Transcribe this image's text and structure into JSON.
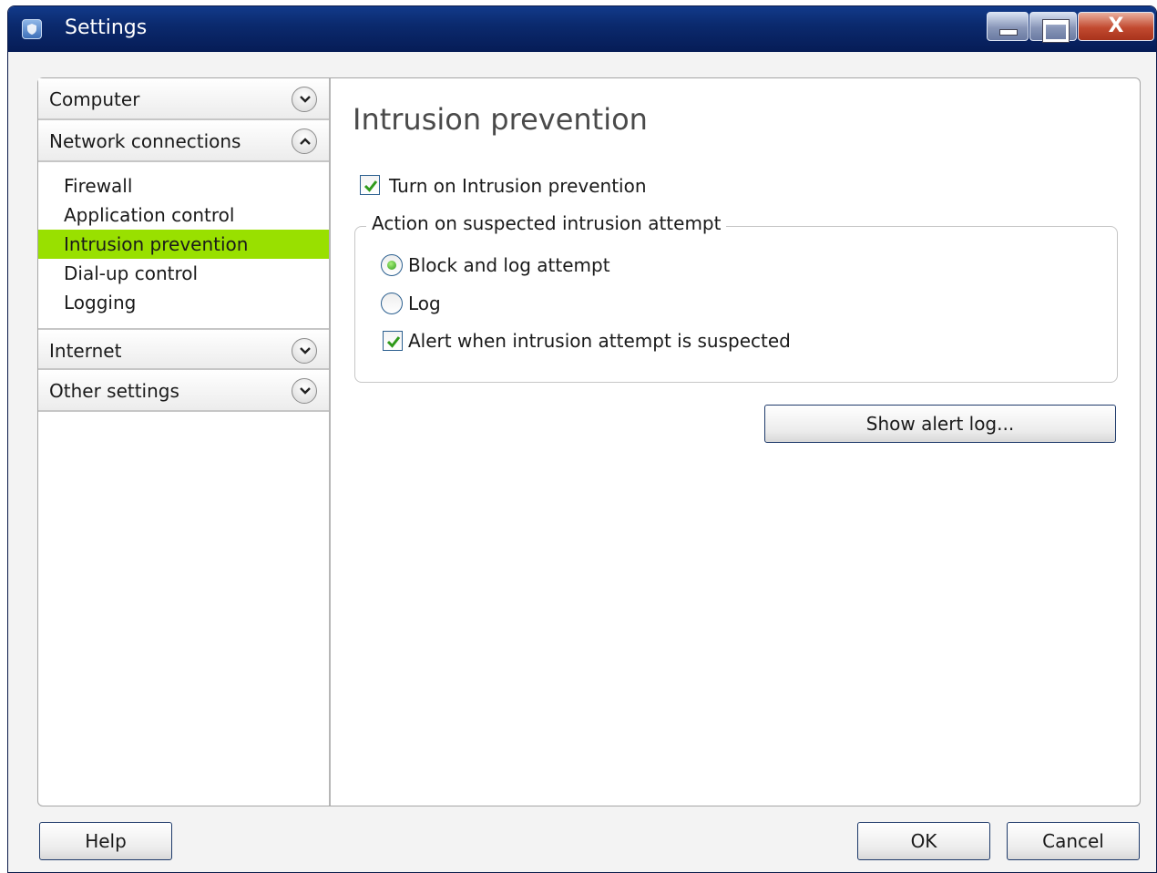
{
  "window": {
    "title": "Settings",
    "close_glyph": "X"
  },
  "sidebar": {
    "categories": [
      {
        "label": "Computer",
        "state": "collapsed",
        "icon": "chevron-down-icon"
      },
      {
        "label": "Network connections",
        "state": "expanded",
        "icon": "chevron-up-icon"
      },
      {
        "label": "Internet",
        "state": "collapsed",
        "icon": "chevron-down-icon"
      },
      {
        "label": "Other settings",
        "state": "collapsed",
        "icon": "chevron-down-icon"
      }
    ],
    "network_items": [
      {
        "label": "Firewall",
        "selected": false
      },
      {
        "label": "Application control",
        "selected": false
      },
      {
        "label": "Intrusion prevention",
        "selected": true
      },
      {
        "label": "Dial-up control",
        "selected": false
      },
      {
        "label": "Logging",
        "selected": false
      }
    ],
    "selected_color": "#99e000"
  },
  "main": {
    "title": "Intrusion prevention",
    "turn_on": {
      "label": "Turn on Intrusion prevention",
      "checked": true
    },
    "group": {
      "title": "Action on suspected intrusion attempt",
      "options": [
        {
          "label": "Block and log attempt",
          "selected": true
        },
        {
          "label": "Log",
          "selected": false
        }
      ],
      "alert": {
        "label": "Alert when intrusion attempt is suspected",
        "checked": true
      }
    },
    "show_alert_log_label": "Show alert log..."
  },
  "footer": {
    "help_label": "Help",
    "ok_label": "OK",
    "cancel_label": "Cancel"
  },
  "colors": {
    "titlebar": "#0b2a6e",
    "check_mark": "#2f9a1a"
  }
}
